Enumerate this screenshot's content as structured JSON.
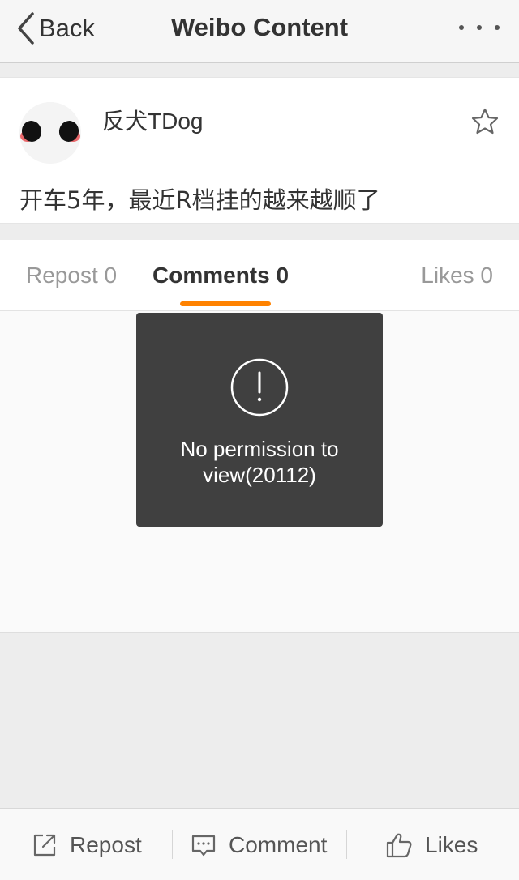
{
  "nav": {
    "back_label": "Back",
    "title": "Weibo Content",
    "back_icon": "chevron-left-icon",
    "more_icon": "more-icon"
  },
  "post": {
    "username": "反犬TDog",
    "text": "开车5年，最近R档挂的越来越顺了",
    "favorite_icon": "star-icon"
  },
  "tabs": [
    {
      "label": "Repost 0",
      "active": false
    },
    {
      "label": "Comments 0",
      "active": true
    },
    {
      "label": "Likes 0",
      "active": false
    }
  ],
  "toast": {
    "icon": "exclamation-circle-icon",
    "message": "No permission to view(20112)"
  },
  "bottom_bar": {
    "repost_label": "Repost",
    "comment_label": "Comment",
    "likes_label": "Likes"
  },
  "colors": {
    "accent": "#ff8200",
    "toast_bg": "#404040"
  }
}
